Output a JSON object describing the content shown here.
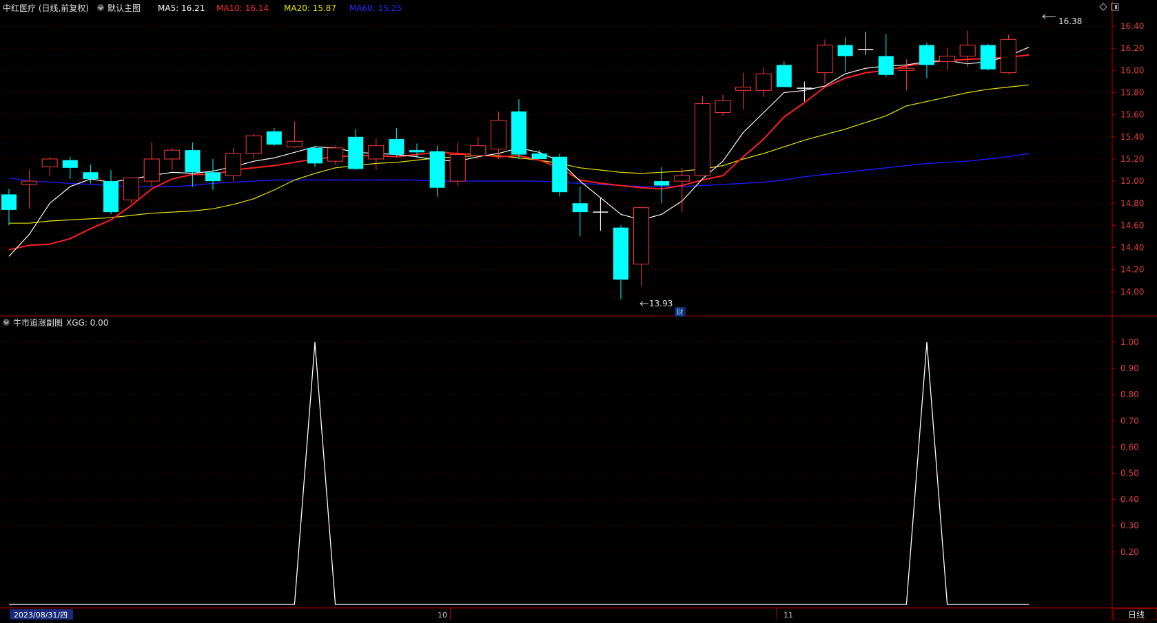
{
  "header": {
    "stock_title": "中红医疗 (日线,前复权)",
    "main_chart_label": "默认主图",
    "ma5": "MA5: 16.21",
    "ma10": "MA10: 16.14",
    "ma20": "MA20: 15.87",
    "ma60": "MA60: 15.25"
  },
  "sub_header": {
    "indicator_title": "牛市追涨副图",
    "indicator_value": "XGG: 0.00"
  },
  "footer": {
    "date_cursor": "2023/08/31/四",
    "month_labels": [
      "10",
      "11"
    ],
    "period_button": "日线"
  },
  "colors": {
    "up": "#ff3b3b",
    "down": "#00ffff",
    "ma5": "#ffffff",
    "ma10": "#ff2020",
    "ma20": "#e8e800",
    "ma60": "#1a1aff",
    "axis": "#b00000",
    "grid": "#3a0000"
  },
  "chart_data": [
    {
      "type": "candlestick",
      "series_count": 51,
      "ylim": [
        13.8,
        16.5
      ],
      "yticks": [
        "16.40",
        "16.20",
        "16.00",
        "15.80",
        "15.60",
        "15.40",
        "15.20",
        "15.00",
        "14.80",
        "14.60",
        "14.40",
        "14.20",
        "14.00"
      ],
      "high_label": "16.38",
      "low_label": "13.93",
      "finance_marker": "财",
      "ohlc": [
        [
          14.88,
          14.93,
          14.6,
          14.74
        ],
        [
          14.97,
          15.1,
          14.75,
          15.0
        ],
        [
          15.13,
          15.22,
          15.05,
          15.2
        ],
        [
          15.19,
          15.22,
          15.02,
          15.12
        ],
        [
          15.08,
          15.15,
          14.98,
          15.02
        ],
        [
          15.0,
          15.1,
          14.7,
          14.72
        ],
        [
          14.83,
          15.03,
          14.8,
          15.03
        ],
        [
          15.0,
          15.35,
          14.95,
          15.2
        ],
        [
          15.2,
          15.3,
          15.1,
          15.28
        ],
        [
          15.28,
          15.35,
          14.95,
          15.08
        ],
        [
          15.08,
          15.2,
          14.92,
          15.0
        ],
        [
          15.05,
          15.3,
          15.0,
          15.25
        ],
        [
          15.25,
          15.43,
          15.21,
          15.41
        ],
        [
          15.45,
          15.48,
          15.32,
          15.33
        ],
        [
          15.31,
          15.54,
          15.3,
          15.36
        ],
        [
          15.3,
          15.32,
          15.13,
          15.16
        ],
        [
          15.18,
          15.32,
          15.15,
          15.3
        ],
        [
          15.4,
          15.47,
          15.1,
          15.11
        ],
        [
          15.2,
          15.38,
          15.1,
          15.32
        ],
        [
          15.38,
          15.48,
          15.22,
          15.24
        ],
        [
          15.28,
          15.34,
          15.21,
          15.26
        ],
        [
          15.27,
          15.32,
          14.86,
          14.94
        ],
        [
          15.0,
          15.35,
          14.96,
          15.24
        ],
        [
          15.23,
          15.4,
          15.2,
          15.32
        ],
        [
          15.29,
          15.63,
          15.2,
          15.55
        ],
        [
          15.63,
          15.74,
          15.2,
          15.24
        ],
        [
          15.25,
          15.28,
          15.2,
          15.2
        ],
        [
          15.22,
          15.25,
          14.86,
          14.9
        ],
        [
          14.8,
          14.95,
          14.5,
          14.72
        ],
        [
          14.72,
          14.85,
          14.55,
          14.72
        ],
        [
          14.58,
          14.6,
          13.93,
          14.11
        ],
        [
          14.25,
          14.76,
          14.05,
          14.76
        ],
        [
          15.0,
          15.13,
          14.8,
          14.96
        ],
        [
          15.0,
          15.12,
          14.72,
          15.05
        ],
        [
          15.05,
          15.77,
          15.05,
          15.7
        ],
        [
          15.62,
          15.78,
          15.59,
          15.73
        ],
        [
          15.82,
          15.98,
          15.65,
          15.85
        ],
        [
          15.82,
          16.03,
          15.76,
          15.97
        ],
        [
          16.05,
          16.08,
          15.88,
          15.85
        ],
        [
          15.85,
          15.9,
          15.72,
          15.84
        ],
        [
          15.98,
          16.28,
          15.88,
          16.23
        ],
        [
          16.23,
          16.3,
          15.99,
          16.13
        ],
        [
          16.19,
          16.35,
          16.14,
          16.19
        ],
        [
          16.13,
          16.33,
          15.94,
          15.96
        ],
        [
          16.0,
          16.1,
          15.82,
          16.02
        ],
        [
          16.23,
          16.25,
          15.93,
          16.05
        ],
        [
          16.08,
          16.2,
          16.0,
          16.13
        ],
        [
          16.13,
          16.36,
          16.03,
          16.23
        ],
        [
          16.23,
          16.24,
          16.0,
          16.01
        ],
        [
          15.98,
          16.32,
          15.97,
          16.28
        ]
      ],
      "ma5": [
        14.32,
        14.52,
        14.8,
        14.95,
        15.02,
        14.99,
        15.02,
        15.05,
        15.08,
        15.07,
        15.09,
        15.13,
        15.18,
        15.21,
        15.26,
        15.31,
        15.3,
        15.26,
        15.25,
        15.24,
        15.22,
        15.19,
        15.18,
        15.22,
        15.25,
        15.3,
        15.26,
        15.18,
        15.0,
        14.85,
        14.7,
        14.65,
        14.7,
        14.82,
        15.02,
        15.18,
        15.44,
        15.62,
        15.8,
        15.82,
        15.86,
        15.97,
        16.02,
        16.04,
        16.05,
        16.08,
        16.09,
        16.06,
        16.08,
        16.13,
        16.21
      ],
      "ma10": [
        14.38,
        14.42,
        14.43,
        14.48,
        14.57,
        14.65,
        14.78,
        14.93,
        15.02,
        15.06,
        15.06,
        15.1,
        15.12,
        15.14,
        15.17,
        15.2,
        15.22,
        15.23,
        15.23,
        15.22,
        15.24,
        15.26,
        15.25,
        15.24,
        15.22,
        15.23,
        15.19,
        15.12,
        15.01,
        14.98,
        14.96,
        14.94,
        14.93,
        14.96,
        15.01,
        15.05,
        15.22,
        15.38,
        15.58,
        15.71,
        15.85,
        15.93,
        15.98,
        16.0,
        16.04,
        16.07,
        16.09,
        16.1,
        16.11,
        16.12,
        16.14
      ],
      "ma20": [
        14.62,
        14.62,
        14.64,
        14.65,
        14.66,
        14.67,
        14.69,
        14.71,
        14.72,
        14.73,
        14.75,
        14.79,
        14.84,
        14.92,
        15.01,
        15.07,
        15.12,
        15.14,
        15.16,
        15.17,
        15.19,
        15.21,
        15.22,
        15.23,
        15.23,
        15.21,
        15.19,
        15.16,
        15.12,
        15.1,
        15.08,
        15.07,
        15.08,
        15.09,
        15.11,
        15.14,
        15.2,
        15.25,
        15.31,
        15.37,
        15.42,
        15.47,
        15.53,
        15.59,
        15.68,
        15.72,
        15.76,
        15.8,
        15.83,
        15.85,
        15.87
      ],
      "ma60": [
        15.03,
        15.0,
        14.99,
        14.98,
        14.97,
        14.96,
        14.95,
        14.95,
        14.95,
        14.96,
        14.98,
        14.99,
        15.0,
        15.01,
        15.01,
        15.01,
        15.01,
        15.01,
        15.01,
        15.01,
        15.01,
        15.0,
        15.0,
        15.0,
        15.0,
        15.0,
        15.0,
        14.99,
        14.98,
        14.97,
        14.96,
        14.95,
        14.95,
        14.95,
        14.96,
        14.97,
        14.98,
        14.99,
        15.01,
        15.04,
        15.06,
        15.08,
        15.1,
        15.12,
        15.14,
        15.16,
        15.17,
        15.18,
        15.2,
        15.22,
        15.25
      ]
    },
    {
      "type": "line",
      "name": "XGG",
      "ylim": [
        0,
        1.05
      ],
      "yticks": [
        "1.00",
        "0.90",
        "0.80",
        "0.70",
        "0.60",
        "0.50",
        "0.40",
        "0.30",
        "0.20"
      ],
      "values": [
        0,
        0,
        0,
        0,
        0,
        0,
        0,
        0,
        0,
        0,
        0,
        0,
        0,
        0,
        0,
        1,
        0,
        0,
        0,
        0,
        0,
        0,
        0,
        0,
        0,
        0,
        0,
        0,
        0,
        0,
        0,
        0,
        0,
        0,
        0,
        0,
        0,
        0,
        0,
        0,
        0,
        0,
        0,
        0,
        0,
        1,
        0,
        0,
        0,
        0,
        0
      ]
    }
  ]
}
